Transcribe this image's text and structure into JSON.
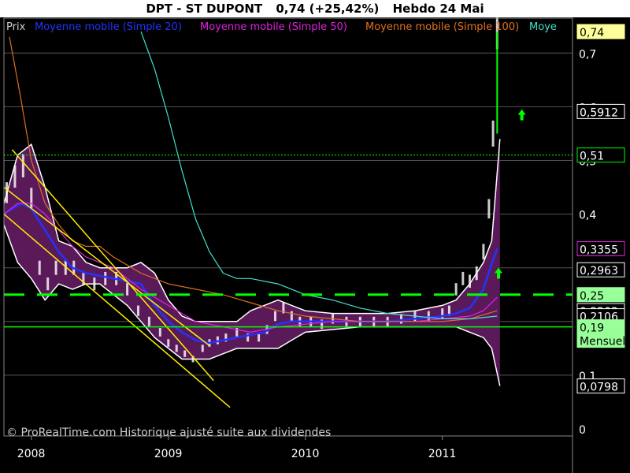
{
  "header": {
    "instrument": "DPT - ST DUPONT",
    "quote": "0,74 (+25,42%)",
    "period": "Hebdo 24 Mai"
  },
  "legend": [
    {
      "label": "Prix",
      "color": "#cfcfcf"
    },
    {
      "label": "Moyenne mobile (Simple 20)",
      "color": "#2233ff"
    },
    {
      "label": "Moyenne mobile (Simple 50)",
      "color": "#e020e0"
    },
    {
      "label": "Moyenne mobile (Simple 100)",
      "color": "#e07020"
    },
    {
      "label": "Moye",
      "color": "#40e0d0"
    }
  ],
  "footer": "© ProRealTime.com Historique ajusté suite aux dividendes",
  "colors": {
    "background": "#000000",
    "grid": "#555555",
    "price_bar": "#ffffff",
    "bollinger_fill": "#5a1a5a",
    "support_line": "#00ff00",
    "channel_line": "#ffee00",
    "arrow": "#00ff00"
  },
  "chart_data": {
    "type": "line",
    "title": "DPT - ST DUPONT",
    "xlabel": "",
    "ylabel": "",
    "x_ticks": [
      "2008",
      "2009",
      "2010",
      "2011"
    ],
    "y_ticks": [
      "0",
      "0,1",
      "0,4",
      "0,5",
      "0,6",
      "0,7"
    ],
    "ylim": [
      0,
      0.74
    ],
    "xlim": [
      2007.8,
      2011.95
    ],
    "price_labels": [
      {
        "text": "0,74",
        "value": 0.74,
        "style": "last"
      },
      {
        "text": "0,5912",
        "value": 0.5912,
        "style": "plain"
      },
      {
        "text": "0,51",
        "value": 0.51,
        "style": "dotted"
      },
      {
        "text": "0,3355",
        "value": 0.3355,
        "style": "magenta"
      },
      {
        "text": "0,2963",
        "value": 0.2963,
        "style": "plain"
      },
      {
        "text": "0,2202",
        "value": 0.2202,
        "style": "plain"
      },
      {
        "text": "0,2106",
        "value": 0.2106,
        "style": "plain"
      },
      {
        "text": "0,25",
        "value": 0.25,
        "style": "green"
      },
      {
        "text": "0,19",
        "value": 0.19,
        "style": "green"
      },
      {
        "text": "Mensuel",
        "value": 0.165,
        "style": "green"
      },
      {
        "text": "0,0798",
        "value": 0.0798,
        "style": "plain"
      }
    ],
    "support_levels": [
      {
        "value": 0.25,
        "style": "dashed"
      },
      {
        "value": 0.19,
        "style": "solid"
      },
      {
        "value": 0.51,
        "style": "dotted"
      }
    ],
    "channel": {
      "upper": [
        [
          2007.86,
          0.52
        ],
        [
          2009.33,
          0.09
        ]
      ],
      "lower": [
        [
          2007.8,
          0.4
        ],
        [
          2009.45,
          0.04
        ]
      ],
      "mid": [
        [
          2007.8,
          0.45
        ],
        [
          2009.3,
          0.155
        ]
      ]
    },
    "arrows": [
      {
        "x": 2011.58,
        "y": 0.585
      },
      {
        "x": 2011.41,
        "y": 0.29
      }
    ],
    "series": [
      {
        "name": "Prix",
        "x": [
          2007.82,
          2007.88,
          2007.94,
          2008.0,
          2008.06,
          2008.12,
          2008.18,
          2008.25,
          2008.31,
          2008.38,
          2008.46,
          2008.54,
          2008.62,
          2008.7,
          2008.78,
          2008.86,
          2008.94,
          2009.0,
          2009.06,
          2009.12,
          2009.18,
          2009.25,
          2009.3,
          2009.36,
          2009.42,
          2009.5,
          2009.58,
          2009.66,
          2009.72,
          2009.78,
          2009.84,
          2009.9,
          2009.96,
          2010.04,
          2010.12,
          2010.2,
          2010.3,
          2010.4,
          2010.5,
          2010.6,
          2010.7,
          2010.8,
          2010.9,
          2011.0,
          2011.05,
          2011.1,
          2011.15,
          2011.2,
          2011.25,
          2011.3,
          2011.34,
          2011.37,
          2011.4
        ],
        "values": [
          0.44,
          0.47,
          0.49,
          0.43,
          0.3,
          0.27,
          0.3,
          0.3,
          0.3,
          0.28,
          0.27,
          0.28,
          0.28,
          0.26,
          0.22,
          0.2,
          0.18,
          0.16,
          0.15,
          0.14,
          0.13,
          0.15,
          0.16,
          0.165,
          0.17,
          0.18,
          0.17,
          0.17,
          0.185,
          0.21,
          0.225,
          0.21,
          0.2,
          0.2,
          0.195,
          0.205,
          0.2,
          0.2,
          0.2,
          0.2,
          0.205,
          0.21,
          0.21,
          0.215,
          0.22,
          0.26,
          0.28,
          0.275,
          0.29,
          0.33,
          0.41,
          0.55,
          0.74
        ]
      },
      {
        "name": "Moyenne mobile (Simple 20)",
        "x": [
          2007.8,
          2007.86,
          2007.93,
          2008.0,
          2008.1,
          2008.2,
          2008.3,
          2008.4,
          2008.5,
          2008.6,
          2008.7,
          2008.8,
          2008.9,
          2009.0,
          2009.1,
          2009.2,
          2009.3,
          2009.4,
          2009.5,
          2009.6,
          2009.7,
          2009.8,
          2009.9,
          2010.0,
          2010.2,
          2010.4,
          2010.6,
          2010.8,
          2011.0,
          2011.1,
          2011.2,
          2011.3,
          2011.35,
          2011.4
        ],
        "values": [
          0.4,
          0.41,
          0.42,
          0.41,
          0.37,
          0.33,
          0.3,
          0.29,
          0.285,
          0.28,
          0.275,
          0.27,
          0.23,
          0.2,
          0.18,
          0.165,
          0.16,
          0.165,
          0.17,
          0.175,
          0.18,
          0.195,
          0.2,
          0.2,
          0.2,
          0.2,
          0.2,
          0.205,
          0.21,
          0.215,
          0.225,
          0.26,
          0.3,
          0.3355
        ]
      },
      {
        "name": "Moyenne mobile (Simple 50)",
        "x": [
          2007.8,
          2007.9,
          2008.0,
          2008.1,
          2008.2,
          2008.3,
          2008.4,
          2008.5,
          2008.6,
          2008.7,
          2008.8,
          2008.9,
          2009.0,
          2009.1,
          2009.2,
          2009.4,
          2009.6,
          2009.8,
          2010.0,
          2010.2,
          2010.4,
          2010.6,
          2010.8,
          2011.0,
          2011.2,
          2011.3,
          2011.4
        ],
        "values": [
          0.4,
          0.42,
          0.42,
          0.4,
          0.37,
          0.34,
          0.32,
          0.31,
          0.3,
          0.28,
          0.26,
          0.245,
          0.23,
          0.215,
          0.2,
          0.19,
          0.18,
          0.19,
          0.195,
          0.2,
          0.2,
          0.2,
          0.2,
          0.205,
          0.21,
          0.22,
          0.245
        ]
      },
      {
        "name": "Moyenne mobile (Simple 100)",
        "x": [
          2007.84,
          2007.92,
          2008.0,
          2008.1,
          2008.2,
          2008.3,
          2008.4,
          2008.5,
          2008.6,
          2008.8,
          2009.0,
          2009.2,
          2009.4,
          2009.6,
          2009.8,
          2010.0,
          2010.2,
          2010.4,
          2010.6,
          2010.8,
          2011.0,
          2011.2,
          2011.4
        ],
        "values": [
          0.73,
          0.62,
          0.5,
          0.42,
          0.38,
          0.35,
          0.34,
          0.34,
          0.32,
          0.29,
          0.27,
          0.26,
          0.25,
          0.235,
          0.22,
          0.21,
          0.205,
          0.2,
          0.2,
          0.2,
          0.2,
          0.205,
          0.22
        ]
      },
      {
        "name": "Moye",
        "x": [
          2008.8,
          2008.9,
          2009.0,
          2009.1,
          2009.2,
          2009.3,
          2009.4,
          2009.5,
          2009.6,
          2009.8,
          2010.0,
          2010.2,
          2010.4,
          2010.6,
          2010.8,
          2011.0,
          2011.2,
          2011.4
        ],
        "values": [
          0.74,
          0.67,
          0.58,
          0.48,
          0.39,
          0.33,
          0.29,
          0.28,
          0.28,
          0.27,
          0.25,
          0.24,
          0.225,
          0.215,
          0.21,
          0.205,
          0.205,
          0.21
        ]
      }
    ],
    "bollinger": {
      "x": [
        2007.8,
        2007.9,
        2008.0,
        2008.1,
        2008.2,
        2008.3,
        2008.4,
        2008.5,
        2008.6,
        2008.7,
        2008.8,
        2008.9,
        2009.0,
        2009.1,
        2009.2,
        2009.3,
        2009.4,
        2009.5,
        2009.6,
        2009.7,
        2009.8,
        2009.9,
        2010.0,
        2010.2,
        2010.4,
        2010.6,
        2010.8,
        2011.0,
        2011.1,
        2011.2,
        2011.3,
        2011.36,
        2011.42
      ],
      "upper": [
        0.42,
        0.51,
        0.53,
        0.45,
        0.35,
        0.34,
        0.31,
        0.3,
        0.3,
        0.3,
        0.31,
        0.29,
        0.24,
        0.21,
        0.2,
        0.2,
        0.2,
        0.2,
        0.22,
        0.23,
        0.24,
        0.23,
        0.22,
        0.215,
        0.215,
        0.215,
        0.22,
        0.23,
        0.24,
        0.27,
        0.31,
        0.35,
        0.54
      ],
      "lower": [
        0.38,
        0.31,
        0.28,
        0.24,
        0.27,
        0.26,
        0.27,
        0.27,
        0.25,
        0.23,
        0.2,
        0.17,
        0.15,
        0.13,
        0.13,
        0.13,
        0.14,
        0.15,
        0.15,
        0.15,
        0.15,
        0.165,
        0.18,
        0.185,
        0.19,
        0.19,
        0.19,
        0.19,
        0.19,
        0.18,
        0.17,
        0.15,
        0.08
      ]
    }
  }
}
